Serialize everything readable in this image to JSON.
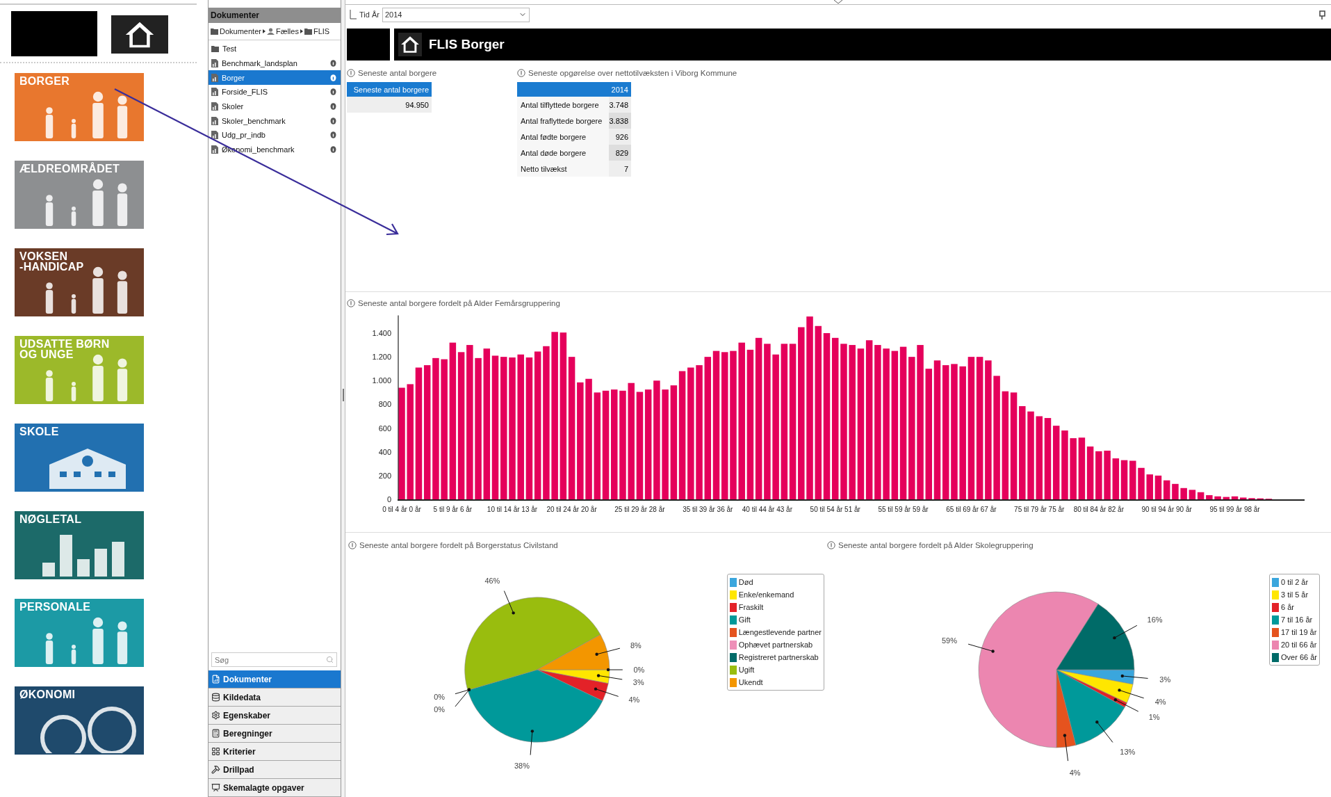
{
  "tiles": [
    {
      "label": "BORGER",
      "color": "#e8772e",
      "kind": "people"
    },
    {
      "label": "ÆLDREOMRÅDET",
      "color": "#8d8f91",
      "kind": "people"
    },
    {
      "label": "VOKSEN\n-HANDICAP",
      "color": "#6a3b27",
      "kind": "people"
    },
    {
      "label": "UDSATTE BØRN\nOG UNGE",
      "color": "#9cb92a",
      "kind": "people"
    },
    {
      "label": "SKOLE",
      "color": "#2270b0",
      "kind": "school"
    },
    {
      "label": "NØGLETAL",
      "color": "#1c6a69",
      "kind": "chart"
    },
    {
      "label": "PERSONALE",
      "color": "#1c9aa5",
      "kind": "people"
    },
    {
      "label": "ØKONOMI",
      "color": "#1f4a6c",
      "kind": "coins"
    }
  ],
  "documents_panel": {
    "title": "Dokumenter",
    "breadcrumb": [
      "Dokumenter",
      "Fælles",
      "FLIS"
    ],
    "items": [
      {
        "label": "Test",
        "kind": "folder",
        "selected": false
      },
      {
        "label": "Benchmark_landsplan",
        "kind": "report",
        "selected": false
      },
      {
        "label": "Borger",
        "kind": "report",
        "selected": true
      },
      {
        "label": "Forside_FLIS",
        "kind": "report",
        "selected": false
      },
      {
        "label": "Skoler",
        "kind": "report",
        "selected": false
      },
      {
        "label": "Skoler_benchmark",
        "kind": "report",
        "selected": false
      },
      {
        "label": "Udg_pr_indb",
        "kind": "report",
        "selected": false
      },
      {
        "label": "Økonomi_benchmark",
        "kind": "report",
        "selected": false
      }
    ],
    "search": {
      "placeholder": "Søg"
    },
    "nav": [
      {
        "label": "Dokumenter",
        "selected": true
      },
      {
        "label": "Kildedata",
        "selected": false
      },
      {
        "label": "Egenskaber",
        "selected": false
      },
      {
        "label": "Beregninger",
        "selected": false
      },
      {
        "label": "Kriterier",
        "selected": false
      },
      {
        "label": "Drillpad",
        "selected": false
      },
      {
        "label": "Skemalagte opgaver",
        "selected": false
      }
    ]
  },
  "filter": {
    "label": "Tid År",
    "value": "2014"
  },
  "header": {
    "title": "FLIS Borger"
  },
  "current_count": {
    "title": "Seneste antal borgere",
    "column": "Seneste antal borgere",
    "value": "94.950"
  },
  "net_growth": {
    "title": "Seneste opgørelse over nettotilvæksten i Viborg Kommune",
    "column": "2014",
    "rows": [
      {
        "label": "Antal tilflyttede borgere",
        "value": "3.748"
      },
      {
        "label": "Antal fraflyttede borgere",
        "value": "3.838"
      },
      {
        "label": "Antal fødte borgere",
        "value": "926"
      },
      {
        "label": "Antal døde borgere",
        "value": "829"
      },
      {
        "label": "Netto tilvækst",
        "value": "7"
      }
    ]
  },
  "age_chart": {
    "title": "Seneste antal borgere fordelt på Alder Femårsgruppering",
    "chart_data": {
      "type": "bar",
      "values": [
        940,
        970,
        1110,
        1130,
        1190,
        1180,
        1320,
        1240,
        1300,
        1190,
        1270,
        1210,
        1200,
        1195,
        1220,
        1195,
        1245,
        1290,
        1410,
        1405,
        1200,
        985,
        1015,
        900,
        915,
        925,
        915,
        980,
        905,
        925,
        1000,
        925,
        960,
        1080,
        1110,
        1130,
        1200,
        1250,
        1240,
        1250,
        1320,
        1260,
        1360,
        1310,
        1220,
        1310,
        1310,
        1450,
        1540,
        1460,
        1400,
        1360,
        1310,
        1300,
        1270,
        1340,
        1300,
        1270,
        1250,
        1285,
        1200,
        1300,
        1100,
        1170,
        1130,
        1140,
        1120,
        1200,
        1200,
        1170,
        1040,
        910,
        900,
        785,
        740,
        700,
        685,
        620,
        580,
        515,
        520,
        445,
        405,
        410,
        345,
        330,
        325,
        265,
        210,
        200,
        160,
        130,
        95,
        80,
        60,
        35,
        25,
        20,
        25,
        15,
        10,
        8,
        5
      ],
      "ylim": [
        0,
        1550
      ],
      "yticks": [
        {
          "value": 0,
          "label": "0"
        },
        {
          "value": 200,
          "label": "200"
        },
        {
          "value": 400,
          "label": "400"
        },
        {
          "value": 600,
          "label": "600"
        },
        {
          "value": 800,
          "label": "800"
        },
        {
          "value": 1000,
          "label": "1.000"
        },
        {
          "value": 1200,
          "label": "1.200"
        },
        {
          "value": 1400,
          "label": "1.400"
        }
      ],
      "categories": [
        "0 til 4 år 0 år",
        null,
        null,
        null,
        null,
        null,
        "5 til 9 år 6 år",
        null,
        null,
        null,
        null,
        null,
        null,
        "10 til 14 år 13 år",
        null,
        null,
        null,
        null,
        null,
        null,
        "20 til 24 år 20 år",
        null,
        null,
        null,
        null,
        null,
        null,
        null,
        "25 til 29 år 28 år",
        null,
        null,
        null,
        null,
        null,
        null,
        null,
        "35 til 39 år 36 år",
        null,
        null,
        null,
        null,
        null,
        null,
        "40 til 44 år 43 år",
        null,
        null,
        null,
        null,
        null,
        null,
        null,
        "50 til 54 år 51 år",
        null,
        null,
        null,
        null,
        null,
        null,
        null,
        "55 til 59 år 59 år",
        null,
        null,
        null,
        null,
        null,
        null,
        null,
        "65 til 69 år 67 år",
        null,
        null,
        null,
        null,
        null,
        null,
        null,
        "75 til 79 år 75 år",
        null,
        null,
        null,
        null,
        null,
        null,
        "80 til 84 år 82 år",
        null,
        null,
        null,
        null,
        null,
        null,
        null,
        "90 til 94 år 90 år",
        null,
        null,
        null,
        null,
        null,
        null,
        null,
        "95 til 99 år 98 år",
        null,
        null,
        null,
        null
      ]
    }
  },
  "civil_status": {
    "title": "Seneste antal borgere fordelt på Borgerstatus Civilstand",
    "legend": [
      {
        "label": "Død",
        "color": "#3aa6dd"
      },
      {
        "label": "Enke/enkemand",
        "color": "#ffe600"
      },
      {
        "label": "Fraskilt",
        "color": "#e32228"
      },
      {
        "label": "Gift",
        "color": "#00999a"
      },
      {
        "label": "Længestlevende partner",
        "color": "#e5531e"
      },
      {
        "label": "Ophævet partnerskab",
        "color": "#ee8fb8"
      },
      {
        "label": "Registreret partnerskab",
        "color": "#006b68"
      },
      {
        "label": "Ugift",
        "color": "#99bd0e"
      },
      {
        "label": "Ukendt",
        "color": "#f39600"
      }
    ],
    "chart_data": {
      "type": "pie",
      "values": [
        0,
        3,
        4,
        38,
        0,
        0,
        0,
        46,
        8
      ],
      "value_labels": [
        "0%",
        "3%",
        "4%",
        "38%",
        null,
        "0%",
        "0%",
        "46%",
        "8%"
      ]
    }
  },
  "school_age": {
    "title": "Seneste antal borgere fordelt på Alder Skolegruppering",
    "legend": [
      {
        "label": "0 til 2 år",
        "color": "#3aa6dd"
      },
      {
        "label": "3 til 5 år",
        "color": "#ffe600"
      },
      {
        "label": "6 år",
        "color": "#e32228"
      },
      {
        "label": "7 til 16 år",
        "color": "#00999a"
      },
      {
        "label": "17 til 19 år",
        "color": "#e5531e"
      },
      {
        "label": "20 til 66 år",
        "color": "#ec86b0"
      },
      {
        "label": "Over 66 år",
        "color": "#006b68"
      }
    ],
    "chart_data": {
      "type": "pie",
      "values": [
        3,
        4,
        1,
        13,
        4,
        59,
        16
      ],
      "value_labels": [
        "3%",
        "4%",
        "1%",
        "13%",
        "4%",
        "59%",
        "16%"
      ]
    }
  }
}
